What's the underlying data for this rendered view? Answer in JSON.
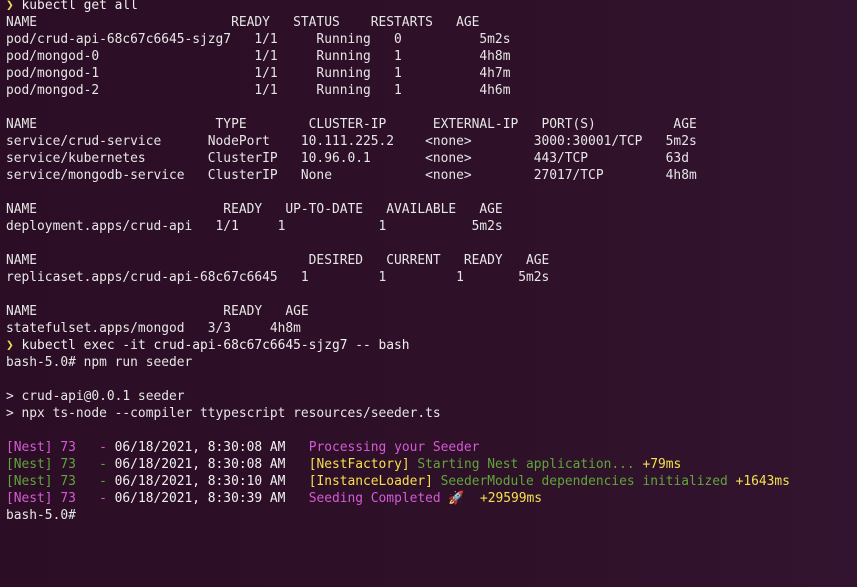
{
  "prompt_symbol": "❯",
  "command1": "kubectl get all",
  "pods": {
    "header": "NAME                         READY   STATUS    RESTARTS   AGE",
    "rows": [
      "pod/crud-api-68c67c6645-sjzg7   1/1     Running   0          5m2s",
      "pod/mongod-0                    1/1     Running   1          4h8m",
      "pod/mongod-1                    1/1     Running   1          4h7m",
      "pod/mongod-2                    1/1     Running   1          4h6m"
    ]
  },
  "services": {
    "header": "NAME                       TYPE        CLUSTER-IP      EXTERNAL-IP   PORT(S)          AGE",
    "rows": [
      "service/crud-service      NodePort    10.111.225.2    <none>        3000:30001/TCP   5m2s",
      "service/kubernetes        ClusterIP   10.96.0.1       <none>        443/TCP          63d",
      "service/mongodb-service   ClusterIP   None            <none>        27017/TCP        4h8m"
    ]
  },
  "deployments": {
    "header": "NAME                        READY   UP-TO-DATE   AVAILABLE   AGE",
    "rows": [
      "deployment.apps/crud-api   1/1     1            1           5m2s"
    ]
  },
  "replicasets": {
    "header": "NAME                                   DESIRED   CURRENT   READY   AGE",
    "rows": [
      "replicaset.apps/crud-api-68c67c6645   1         1         1       5m2s"
    ]
  },
  "statefulsets": {
    "header": "NAME                        READY   AGE",
    "rows": [
      "statefulset.apps/mongod   3/3     4h8m"
    ]
  },
  "command2": "kubectl exec -it crud-api-68c67c6645-sjzg7 -- bash",
  "bash_prompt": "bash-5.0#",
  "bash_cmd": " npm run seeder",
  "npm_line1": "> crud-api@0.0.1 seeder",
  "npm_line2": "> npx ts-node --compiler ttypescript resources/seeder.ts",
  "nest_logs": [
    {
      "prefix": "[Nest] 73   - ",
      "datetime": "06/18/2021, 8:30:08 AM",
      "context": "",
      "message": "Processing your Seeder",
      "timing": "",
      "pink": true
    },
    {
      "prefix": "[Nest] 73   - ",
      "datetime": "06/18/2021, 8:30:08 AM",
      "context": "[NestFactory]",
      "message": "Starting Nest application...",
      "timing": "+79ms",
      "pink": false
    },
    {
      "prefix": "[Nest] 73   - ",
      "datetime": "06/18/2021, 8:30:10 AM",
      "context": "[InstanceLoader]",
      "message": "SeederModule dependencies initialized",
      "timing": "+1643ms",
      "pink": false
    },
    {
      "prefix": "[Nest] 73   - ",
      "datetime": "06/18/2021, 8:30:39 AM",
      "context": "",
      "message": "Seeding Completed 🚀",
      "timing": "+29599ms",
      "pink": true
    }
  ],
  "final_prompt": "bash-5.0#"
}
